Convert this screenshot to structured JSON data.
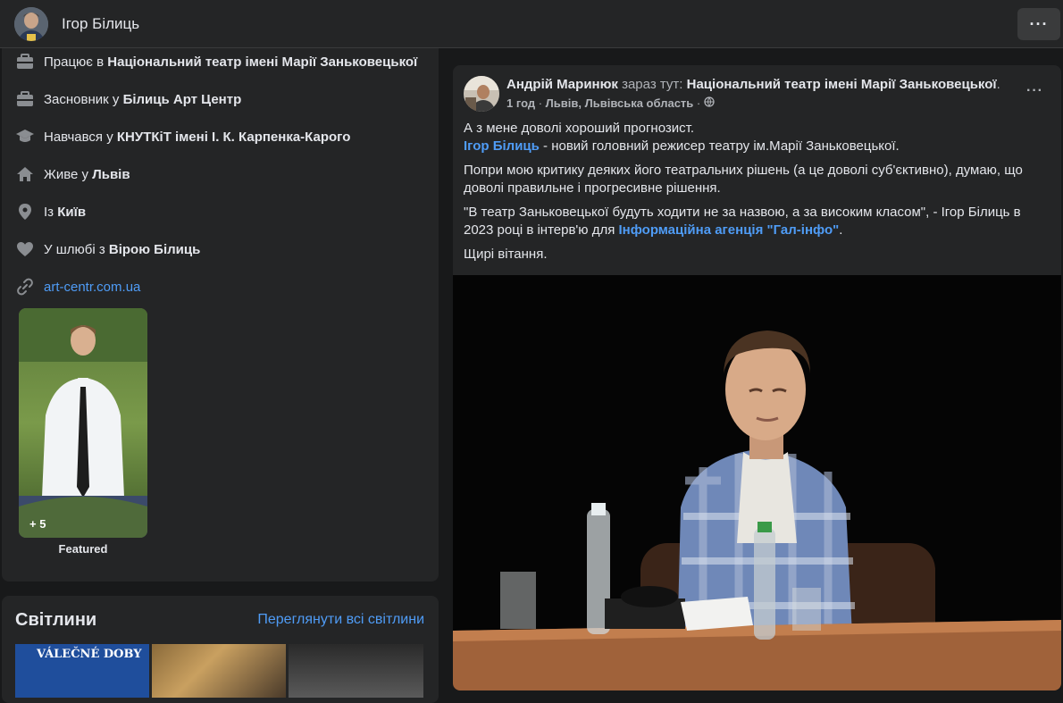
{
  "header": {
    "profile_name": "Ігор Білиць",
    "more_label": "···"
  },
  "intro": {
    "items": [
      {
        "icon": "briefcase-icon",
        "prefix": "Працює в ",
        "value": "Національний театр імені Марії Заньковецької"
      },
      {
        "icon": "briefcase-icon",
        "prefix": "Засновник у ",
        "value": "Білиць Арт Центр"
      },
      {
        "icon": "graduation-cap-icon",
        "prefix": "Навчався у ",
        "value": "КНУТКіТ імені І. К. Карпенка-Карого"
      },
      {
        "icon": "home-icon",
        "prefix": "Живе у ",
        "value": "Львів"
      },
      {
        "icon": "location-pin-icon",
        "prefix": "Із ",
        "value": "Київ"
      },
      {
        "icon": "heart-icon",
        "prefix": "У шлюбі з ",
        "value": "Вірою Білиць"
      }
    ],
    "website": "art-centr.com.ua",
    "featured_count": "+ 5",
    "featured_label": "Featured"
  },
  "photos": {
    "title": "Світлини",
    "see_all": "Переглянути всі світлини",
    "thumb1_text": "VÁLEČNÉ DOBY"
  },
  "post": {
    "author": "Андрій Маринюк",
    "action": " зараз тут: ",
    "place": "Національний театр імені Марії Заньковецької",
    "place_suffix": ".",
    "time": "1 год",
    "location": "Львів, Львівська область",
    "more_label": "···",
    "p1": "А з мене доволі хороший прогнозист.",
    "mention": "Ігор Білиць",
    "p1b": " - новий головний режисер театру ім.Марії Заньковецької.",
    "p2": "Попри мою критику деяких його театральних рішень (а це доволі суб'єктивно), думаю, що доволі правильне і прогресивне рішення.",
    "p3_prefix": "\"В театр Заньковецької будуть ходити не за назвою, а за високим класом\", - Ігор Білиць в 2023 році в інтерв'ю для ",
    "p3_link": "Інформаційна агенція \"Гал-інфо\"",
    "p3_suffix": ".",
    "p4": "Щирі вітання."
  },
  "colors": {
    "background": "#18191a",
    "card": "#242526",
    "link": "#4f9cf6",
    "text_primary": "#e4e6eb",
    "text_secondary": "#b0b3b8"
  }
}
